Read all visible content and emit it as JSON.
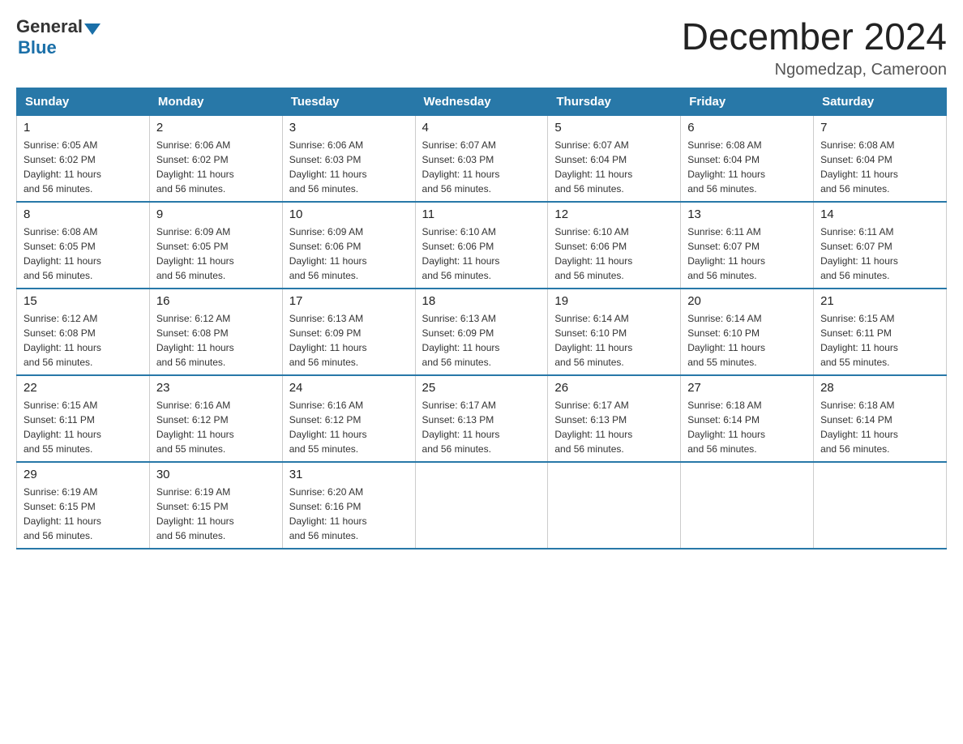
{
  "logo": {
    "general": "General",
    "blue": "Blue"
  },
  "title": "December 2024",
  "location": "Ngomedzap, Cameroon",
  "days_of_week": [
    "Sunday",
    "Monday",
    "Tuesday",
    "Wednesday",
    "Thursday",
    "Friday",
    "Saturday"
  ],
  "weeks": [
    [
      {
        "day": "1",
        "sunrise": "6:05 AM",
        "sunset": "6:02 PM",
        "daylight": "11 hours and 56 minutes."
      },
      {
        "day": "2",
        "sunrise": "6:06 AM",
        "sunset": "6:02 PM",
        "daylight": "11 hours and 56 minutes."
      },
      {
        "day": "3",
        "sunrise": "6:06 AM",
        "sunset": "6:03 PM",
        "daylight": "11 hours and 56 minutes."
      },
      {
        "day": "4",
        "sunrise": "6:07 AM",
        "sunset": "6:03 PM",
        "daylight": "11 hours and 56 minutes."
      },
      {
        "day": "5",
        "sunrise": "6:07 AM",
        "sunset": "6:04 PM",
        "daylight": "11 hours and 56 minutes."
      },
      {
        "day": "6",
        "sunrise": "6:08 AM",
        "sunset": "6:04 PM",
        "daylight": "11 hours and 56 minutes."
      },
      {
        "day": "7",
        "sunrise": "6:08 AM",
        "sunset": "6:04 PM",
        "daylight": "11 hours and 56 minutes."
      }
    ],
    [
      {
        "day": "8",
        "sunrise": "6:08 AM",
        "sunset": "6:05 PM",
        "daylight": "11 hours and 56 minutes."
      },
      {
        "day": "9",
        "sunrise": "6:09 AM",
        "sunset": "6:05 PM",
        "daylight": "11 hours and 56 minutes."
      },
      {
        "day": "10",
        "sunrise": "6:09 AM",
        "sunset": "6:06 PM",
        "daylight": "11 hours and 56 minutes."
      },
      {
        "day": "11",
        "sunrise": "6:10 AM",
        "sunset": "6:06 PM",
        "daylight": "11 hours and 56 minutes."
      },
      {
        "day": "12",
        "sunrise": "6:10 AM",
        "sunset": "6:06 PM",
        "daylight": "11 hours and 56 minutes."
      },
      {
        "day": "13",
        "sunrise": "6:11 AM",
        "sunset": "6:07 PM",
        "daylight": "11 hours and 56 minutes."
      },
      {
        "day": "14",
        "sunrise": "6:11 AM",
        "sunset": "6:07 PM",
        "daylight": "11 hours and 56 minutes."
      }
    ],
    [
      {
        "day": "15",
        "sunrise": "6:12 AM",
        "sunset": "6:08 PM",
        "daylight": "11 hours and 56 minutes."
      },
      {
        "day": "16",
        "sunrise": "6:12 AM",
        "sunset": "6:08 PM",
        "daylight": "11 hours and 56 minutes."
      },
      {
        "day": "17",
        "sunrise": "6:13 AM",
        "sunset": "6:09 PM",
        "daylight": "11 hours and 56 minutes."
      },
      {
        "day": "18",
        "sunrise": "6:13 AM",
        "sunset": "6:09 PM",
        "daylight": "11 hours and 56 minutes."
      },
      {
        "day": "19",
        "sunrise": "6:14 AM",
        "sunset": "6:10 PM",
        "daylight": "11 hours and 56 minutes."
      },
      {
        "day": "20",
        "sunrise": "6:14 AM",
        "sunset": "6:10 PM",
        "daylight": "11 hours and 55 minutes."
      },
      {
        "day": "21",
        "sunrise": "6:15 AM",
        "sunset": "6:11 PM",
        "daylight": "11 hours and 55 minutes."
      }
    ],
    [
      {
        "day": "22",
        "sunrise": "6:15 AM",
        "sunset": "6:11 PM",
        "daylight": "11 hours and 55 minutes."
      },
      {
        "day": "23",
        "sunrise": "6:16 AM",
        "sunset": "6:12 PM",
        "daylight": "11 hours and 55 minutes."
      },
      {
        "day": "24",
        "sunrise": "6:16 AM",
        "sunset": "6:12 PM",
        "daylight": "11 hours and 55 minutes."
      },
      {
        "day": "25",
        "sunrise": "6:17 AM",
        "sunset": "6:13 PM",
        "daylight": "11 hours and 56 minutes."
      },
      {
        "day": "26",
        "sunrise": "6:17 AM",
        "sunset": "6:13 PM",
        "daylight": "11 hours and 56 minutes."
      },
      {
        "day": "27",
        "sunrise": "6:18 AM",
        "sunset": "6:14 PM",
        "daylight": "11 hours and 56 minutes."
      },
      {
        "day": "28",
        "sunrise": "6:18 AM",
        "sunset": "6:14 PM",
        "daylight": "11 hours and 56 minutes."
      }
    ],
    [
      {
        "day": "29",
        "sunrise": "6:19 AM",
        "sunset": "6:15 PM",
        "daylight": "11 hours and 56 minutes."
      },
      {
        "day": "30",
        "sunrise": "6:19 AM",
        "sunset": "6:15 PM",
        "daylight": "11 hours and 56 minutes."
      },
      {
        "day": "31",
        "sunrise": "6:20 AM",
        "sunset": "6:16 PM",
        "daylight": "11 hours and 56 minutes."
      },
      null,
      null,
      null,
      null
    ]
  ],
  "labels": {
    "sunrise": "Sunrise:",
    "sunset": "Sunset:",
    "daylight": "Daylight:"
  }
}
